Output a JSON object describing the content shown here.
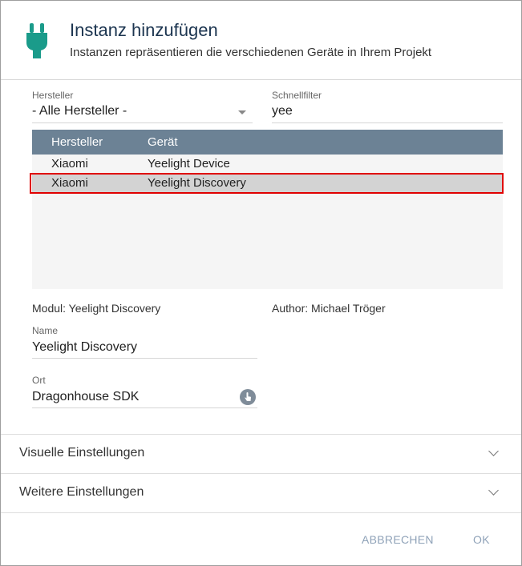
{
  "dialog": {
    "title": "Instanz hinzufügen",
    "subtitle": "Instanzen repräsentieren die verschiedenen Geräte in Ihrem Projekt"
  },
  "filters": {
    "manufacturer_label": "Hersteller",
    "manufacturer_value": "- Alle Hersteller -",
    "quickfilter_label": "Schnellfilter",
    "quickfilter_value": "yee"
  },
  "table": {
    "columns": [
      "Hersteller",
      "Gerät"
    ],
    "rows": [
      {
        "manufacturer": "Xiaomi",
        "device": "Yeelight Device"
      },
      {
        "manufacturer": "Xiaomi",
        "device": "Yeelight Discovery"
      }
    ]
  },
  "details": {
    "module": "Modul: Yeelight Discovery",
    "author": "Author: Michael Tröger",
    "name_label": "Name",
    "name_value": "Yeelight Discovery",
    "location_label": "Ort",
    "location_value": "Dragonhouse SDK"
  },
  "sections": {
    "visual": "Visuelle Einstellungen",
    "further": "Weitere Einstellungen"
  },
  "buttons": {
    "cancel": "ABBRECHEN",
    "ok": "OK"
  },
  "colors": {
    "accent": "#1a9b8a",
    "table_header": "#6c8295",
    "selection_outline": "#e00000"
  }
}
